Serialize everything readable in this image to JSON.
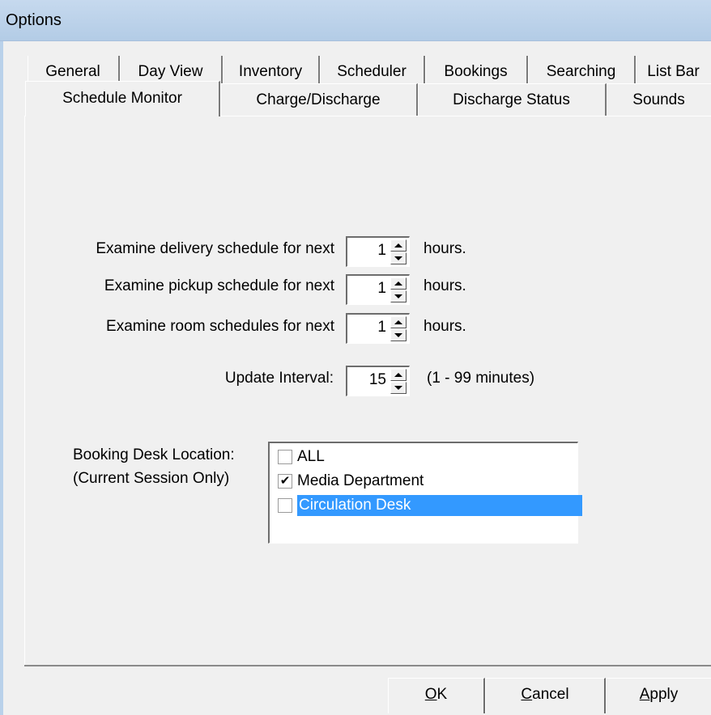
{
  "window": {
    "title": "Options"
  },
  "tabs_back": [
    "General",
    "Day View",
    "Inventory",
    "Scheduler",
    "Bookings",
    "Searching",
    "List Bar"
  ],
  "tabs_front": [
    "Schedule Monitor",
    "Charge/Discharge",
    "Discharge Status",
    "Sounds"
  ],
  "active_tab": "Schedule Monitor",
  "schedule": {
    "delivery_label": "Examine delivery schedule for next",
    "delivery_value": "1",
    "pickup_label": "Examine pickup schedule for next",
    "pickup_value": "1",
    "room_label": "Examine room schedules for next",
    "room_value": "1",
    "hours_unit": "hours.",
    "interval_label": "Update Interval:",
    "interval_value": "15",
    "interval_range": "(1 - 99 minutes)"
  },
  "booking_desk": {
    "label_line1": "Booking Desk Location:",
    "label_line2": "(Current Session Only)",
    "items": [
      {
        "label": "ALL",
        "checked": false,
        "selected": false
      },
      {
        "label": "Media Department",
        "checked": true,
        "selected": false
      },
      {
        "label": "Circulation Desk",
        "checked": false,
        "selected": true
      }
    ],
    "check_mark": "✔"
  },
  "buttons": {
    "ok_mnemonic": "O",
    "ok_rest": "K",
    "cancel_mnemonic": "C",
    "cancel_rest": "ancel",
    "apply_mnemonic": "A",
    "apply_rest": "pply"
  },
  "colors": {
    "titlebar": "#b9d1ea",
    "selection": "#3399ff",
    "face": "#f0f0f0"
  }
}
